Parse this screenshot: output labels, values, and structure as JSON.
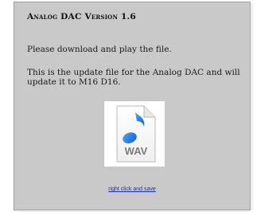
{
  "title": "Analog DAC Version 1.6",
  "intro": "Please download and play the file.",
  "description": "This is the update file for the Analog DAC and will update it to M16 D16.",
  "file_icon": {
    "name": "wav-file-icon",
    "label": "WAV",
    "accent": "#2f7fd4"
  },
  "download_link": "right click and save"
}
